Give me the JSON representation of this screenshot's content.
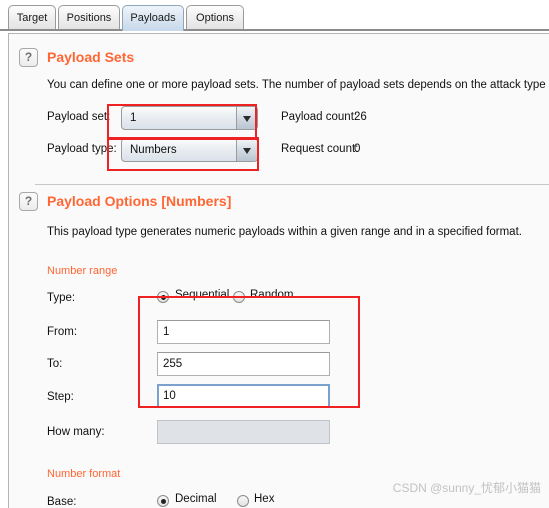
{
  "tabs": [
    {
      "label": "Target",
      "selected": false
    },
    {
      "label": "Positions",
      "selected": false
    },
    {
      "label": "Payloads",
      "selected": true
    },
    {
      "label": "Options",
      "selected": false
    }
  ],
  "payload_sets": {
    "help_icon": "?",
    "title": "Payload Sets",
    "description": "You can define one or more payload sets. The number of payload sets depends on the attack type defin",
    "payload_set_label": "Payload set:",
    "payload_set_value": "1",
    "payload_type_label": "Payload type:",
    "payload_type_value": "Numbers",
    "payload_count_label": "Payload count:",
    "payload_count_value": "26",
    "request_count_label": "Request count:",
    "request_count_value": "0"
  },
  "payload_options": {
    "help_icon": "?",
    "title": "Payload Options [Numbers]",
    "description": "This payload type generates numeric payloads within a given range and in a specified format.",
    "number_range": {
      "heading": "Number range",
      "type_label": "Type:",
      "type_options": [
        "Sequential",
        "Random"
      ],
      "type_selected": "Sequential",
      "from_label": "From:",
      "from_value": "1",
      "to_label": "To:",
      "to_value": "255",
      "step_label": "Step:",
      "step_value": "10",
      "how_many_label": "How many:",
      "how_many_value": ""
    },
    "number_format": {
      "heading": "Number format",
      "base_label": "Base:",
      "base_options": [
        "Decimal",
        "Hex"
      ],
      "base_selected": "Decimal"
    }
  },
  "watermark": "CSDN @sunny_忧郁小猫猫",
  "colors": {
    "accent": "#ff6633",
    "annotation": "#ee2222",
    "focus": "#7ba2cc"
  }
}
